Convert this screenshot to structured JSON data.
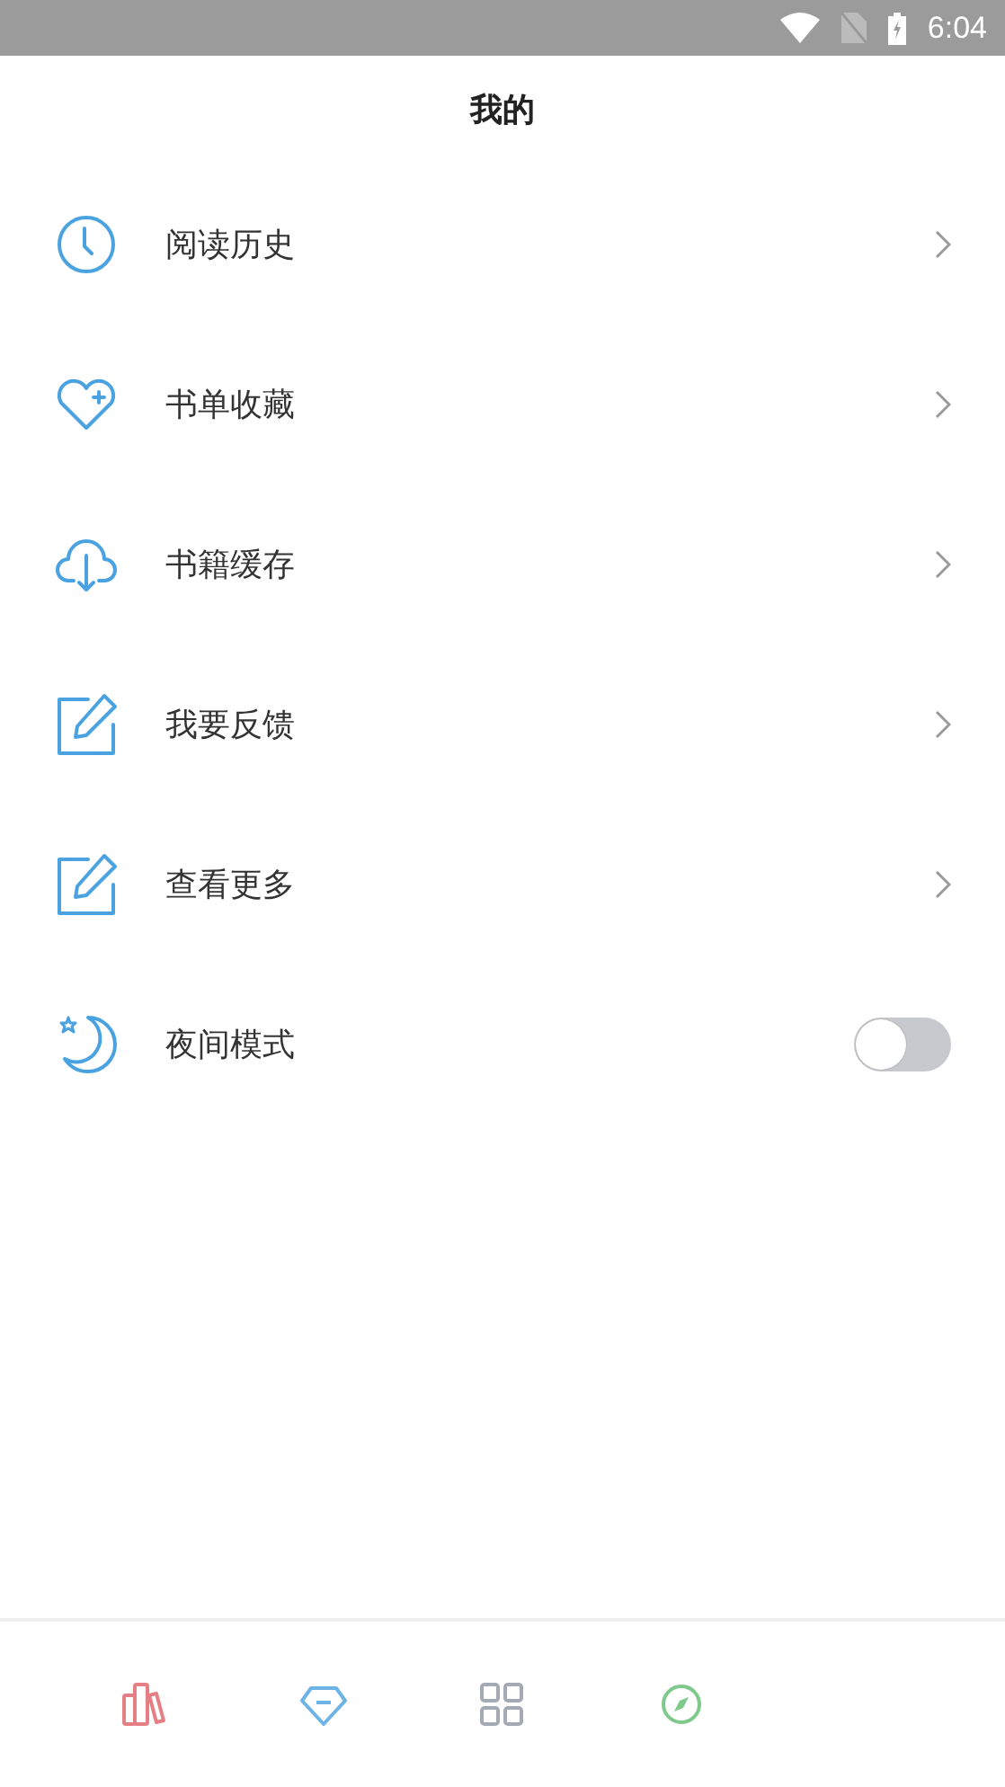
{
  "status_bar": {
    "time": "6:04"
  },
  "header": {
    "title": "我的"
  },
  "menu": [
    {
      "kind": "link",
      "label": "阅读历史"
    },
    {
      "kind": "link",
      "label": "书单收藏"
    },
    {
      "kind": "link",
      "label": "书籍缓存"
    },
    {
      "kind": "link",
      "label": "我要反馈"
    },
    {
      "kind": "link",
      "label": "查看更多"
    },
    {
      "kind": "toggle",
      "label": "夜间模式",
      "on": false
    }
  ],
  "tab_bar": [
    {
      "color": "#e57f85"
    },
    {
      "color": "#6db3e6"
    },
    {
      "color": "#a3aab5"
    },
    {
      "color": "#7fc98c"
    }
  ]
}
